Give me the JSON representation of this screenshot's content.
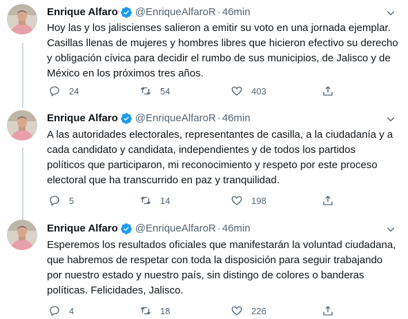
{
  "tweets": [
    {
      "author": "Enrique Alfaro",
      "handle": "@EnriqueAlfaroR",
      "separator": "·",
      "time": "46min",
      "text": "Hoy las y los jaliscienses salieron a emitir su voto en una jornada ejemplar.\nCasillas llenas de mujeres y hombres libres que hicieron efectivo su derecho\ny obligación cívica para decidir el rumbo de sus municipios, de Jalisco y de\nMéxico en los próximos tres años.",
      "replies": "24",
      "retweets": "54",
      "likes": "403"
    },
    {
      "author": "Enrique Alfaro",
      "handle": "@EnriqueAlfaroR",
      "separator": "·",
      "time": "46min",
      "text": "A las autoridades electorales, representantes de casilla, a la ciudadanía y a\ncada candidato y candidata, independientes y de todos los partidos\npolíticos que participaron, mi reconocimiento y respeto por este proceso\nelectoral que ha transcurrido en paz y tranquilidad.",
      "replies": "5",
      "retweets": "14",
      "likes": "198"
    },
    {
      "author": "Enrique Alfaro",
      "handle": "@EnriqueAlfaroR",
      "separator": "·",
      "time": "46min",
      "text": "Esperemos los resultados oficiales que manifestarán la voluntad ciudadana,\nque habremos de respetar con toda la disposición para seguir trabajando\npor nuestro estado y nuestro país, sin distingo de colores o banderas\npolíticas. Felicidades, Jalisco.",
      "replies": "4",
      "retweets": "18",
      "likes": "226"
    }
  ],
  "icons": {
    "verified": "verified-badge-icon",
    "more": "chevron-down-icon",
    "reply": "reply-icon",
    "retweet": "retweet-icon",
    "like": "heart-icon",
    "share": "share-icon"
  },
  "colors": {
    "accent": "#1d9bf0",
    "text": "#0f1419",
    "secondary": "#536471",
    "thread_line": "#cfd9de"
  }
}
